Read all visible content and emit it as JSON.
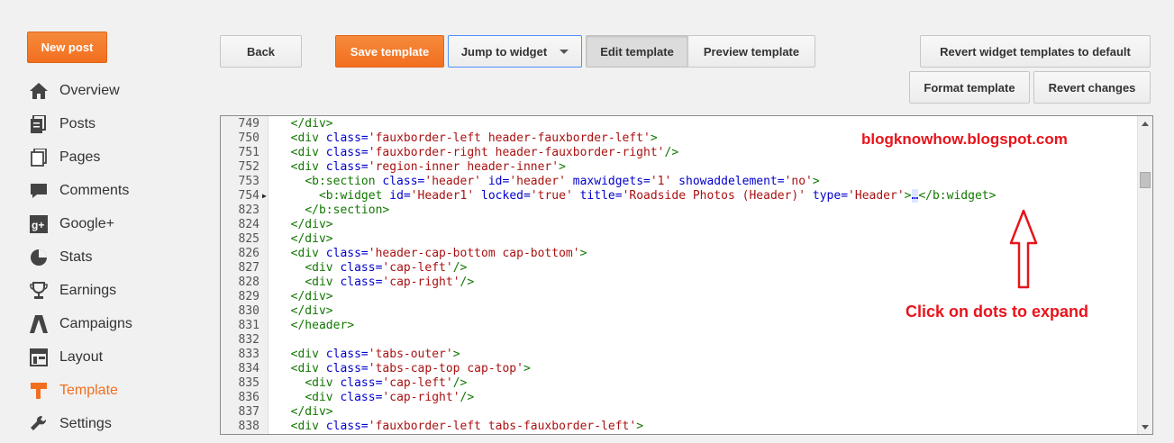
{
  "sidebar": {
    "new_post_label": "New post",
    "items": [
      {
        "label": "Overview",
        "icon": "home-icon"
      },
      {
        "label": "Posts",
        "icon": "posts-icon"
      },
      {
        "label": "Pages",
        "icon": "pages-icon"
      },
      {
        "label": "Comments",
        "icon": "comments-icon"
      },
      {
        "label": "Google+",
        "icon": "google-plus-icon"
      },
      {
        "label": "Stats",
        "icon": "stats-icon"
      },
      {
        "label": "Earnings",
        "icon": "earnings-icon"
      },
      {
        "label": "Campaigns",
        "icon": "campaigns-icon"
      },
      {
        "label": "Layout",
        "icon": "layout-icon"
      },
      {
        "label": "Template",
        "icon": "template-icon",
        "active": true
      },
      {
        "label": "Settings",
        "icon": "settings-icon"
      }
    ]
  },
  "toolbar": {
    "back_label": "Back",
    "save_label": "Save template",
    "jump_label": "Jump to widget",
    "edit_label": "Edit template",
    "preview_label": "Preview template",
    "revert_widgets_label": "Revert widget templates to default",
    "format_label": "Format template",
    "revert_changes_label": "Revert changes"
  },
  "editor": {
    "lines": [
      {
        "n": "749",
        "code": [
          [
            "p",
            "  "
          ],
          [
            "t",
            "</div>"
          ]
        ]
      },
      {
        "n": "750",
        "code": [
          [
            "p",
            "  "
          ],
          [
            "t",
            "<div "
          ],
          [
            "a",
            "class="
          ],
          [
            "v",
            "'fauxborder-left header-fauxborder-left'"
          ],
          [
            "t",
            ">"
          ]
        ]
      },
      {
        "n": "751",
        "code": [
          [
            "p",
            "  "
          ],
          [
            "t",
            "<div "
          ],
          [
            "a",
            "class="
          ],
          [
            "v",
            "'fauxborder-right header-fauxborder-right'"
          ],
          [
            "t",
            "/>"
          ]
        ]
      },
      {
        "n": "752",
        "code": [
          [
            "p",
            "  "
          ],
          [
            "t",
            "<div "
          ],
          [
            "a",
            "class="
          ],
          [
            "v",
            "'region-inner header-inner'"
          ],
          [
            "t",
            ">"
          ]
        ]
      },
      {
        "n": "753",
        "code": [
          [
            "p",
            "    "
          ],
          [
            "t",
            "<b:section "
          ],
          [
            "a",
            "class="
          ],
          [
            "v",
            "'header' "
          ],
          [
            "a",
            "id="
          ],
          [
            "v",
            "'header' "
          ],
          [
            "a",
            "maxwidgets="
          ],
          [
            "v",
            "'1' "
          ],
          [
            "a",
            "showaddelement="
          ],
          [
            "v",
            "'no'"
          ],
          [
            "t",
            ">"
          ]
        ]
      },
      {
        "n": "754",
        "folded": true,
        "code": [
          [
            "p",
            "      "
          ],
          [
            "t",
            "<b:widget "
          ],
          [
            "a",
            "id="
          ],
          [
            "v",
            "'Header1' "
          ],
          [
            "a",
            "locked="
          ],
          [
            "v",
            "'true' "
          ],
          [
            "a",
            "title="
          ],
          [
            "v",
            "'Roadside Photos (Header)' "
          ],
          [
            "a",
            "type="
          ],
          [
            "v",
            "'Header'"
          ],
          [
            "t",
            ">"
          ],
          [
            "f",
            "…"
          ],
          [
            "t",
            "</b:widget>"
          ]
        ]
      },
      {
        "n": "823",
        "code": [
          [
            "p",
            "    "
          ],
          [
            "t",
            "</b:section>"
          ]
        ]
      },
      {
        "n": "824",
        "code": [
          [
            "p",
            "  "
          ],
          [
            "t",
            "</div>"
          ]
        ]
      },
      {
        "n": "825",
        "code": [
          [
            "p",
            "  "
          ],
          [
            "t",
            "</div>"
          ]
        ]
      },
      {
        "n": "826",
        "code": [
          [
            "p",
            "  "
          ],
          [
            "t",
            "<div "
          ],
          [
            "a",
            "class="
          ],
          [
            "v",
            "'header-cap-bottom cap-bottom'"
          ],
          [
            "t",
            ">"
          ]
        ]
      },
      {
        "n": "827",
        "code": [
          [
            "p",
            "    "
          ],
          [
            "t",
            "<div "
          ],
          [
            "a",
            "class="
          ],
          [
            "v",
            "'cap-left'"
          ],
          [
            "t",
            "/>"
          ]
        ]
      },
      {
        "n": "828",
        "code": [
          [
            "p",
            "    "
          ],
          [
            "t",
            "<div "
          ],
          [
            "a",
            "class="
          ],
          [
            "v",
            "'cap-right'"
          ],
          [
            "t",
            "/>"
          ]
        ]
      },
      {
        "n": "829",
        "code": [
          [
            "p",
            "  "
          ],
          [
            "t",
            "</div>"
          ]
        ]
      },
      {
        "n": "830",
        "code": [
          [
            "p",
            "  "
          ],
          [
            "t",
            "</div>"
          ]
        ]
      },
      {
        "n": "831",
        "code": [
          [
            "p",
            "  "
          ],
          [
            "t",
            "</header>"
          ]
        ]
      },
      {
        "n": "832",
        "code": []
      },
      {
        "n": "833",
        "code": [
          [
            "p",
            "  "
          ],
          [
            "t",
            "<div "
          ],
          [
            "a",
            "class="
          ],
          [
            "v",
            "'tabs-outer'"
          ],
          [
            "t",
            ">"
          ]
        ]
      },
      {
        "n": "834",
        "code": [
          [
            "p",
            "  "
          ],
          [
            "t",
            "<div "
          ],
          [
            "a",
            "class="
          ],
          [
            "v",
            "'tabs-cap-top cap-top'"
          ],
          [
            "t",
            ">"
          ]
        ]
      },
      {
        "n": "835",
        "code": [
          [
            "p",
            "    "
          ],
          [
            "t",
            "<div "
          ],
          [
            "a",
            "class="
          ],
          [
            "v",
            "'cap-left'"
          ],
          [
            "t",
            "/>"
          ]
        ]
      },
      {
        "n": "836",
        "code": [
          [
            "p",
            "    "
          ],
          [
            "t",
            "<div "
          ],
          [
            "a",
            "class="
          ],
          [
            "v",
            "'cap-right'"
          ],
          [
            "t",
            "/>"
          ]
        ]
      },
      {
        "n": "837",
        "code": [
          [
            "p",
            "  "
          ],
          [
            "t",
            "</div>"
          ]
        ]
      },
      {
        "n": "838",
        "code": [
          [
            "p",
            "  "
          ],
          [
            "t",
            "<div "
          ],
          [
            "a",
            "class="
          ],
          [
            "v",
            "'fauxborder-left tabs-fauxborder-left'"
          ],
          [
            "t",
            ">"
          ]
        ]
      }
    ]
  },
  "annotations": {
    "watermark": "blogknowhow.blogspot.com",
    "hint": "Click on dots to expand",
    "color": "#e8141b"
  },
  "colors": {
    "accent": "#f26f1f",
    "tag": "#117700",
    "attr": "#0000cc",
    "value": "#aa1111"
  }
}
